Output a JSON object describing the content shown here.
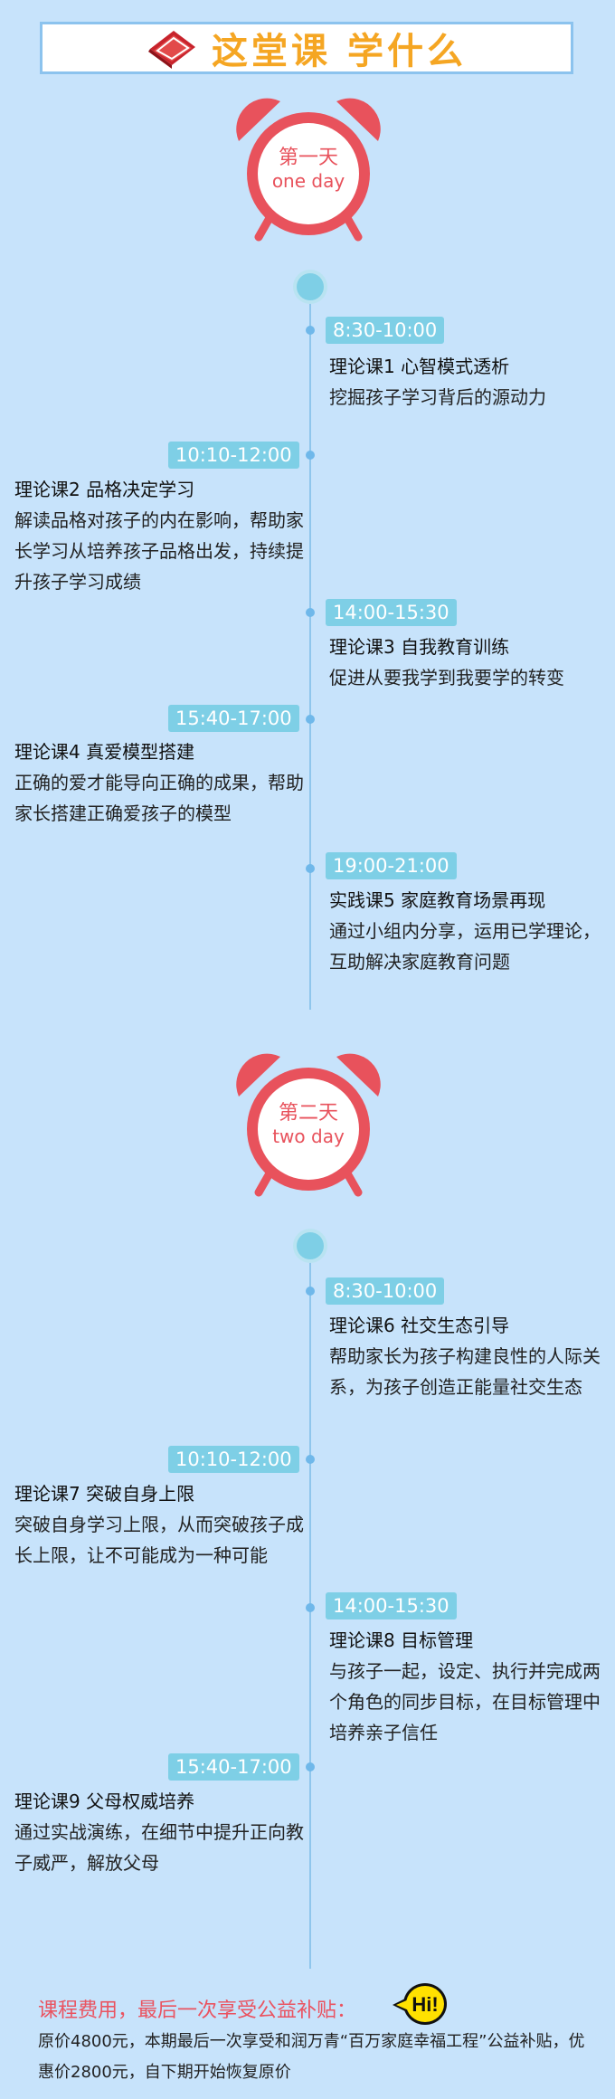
{
  "header": {
    "title": "这堂课 学什么"
  },
  "days": [
    {
      "cn": "第一天",
      "en": "one day",
      "items": [
        {
          "time": "8:30-10:00",
          "title": "理论课1 心智模式透析",
          "desc": "挖掘孩子学习背后的源动力"
        },
        {
          "time": "10:10-12:00",
          "title": "理论课2 品格决定学习",
          "desc": "解读品格对孩子的内在影响，帮助家长学习从培养孩子品格出发，持续提升孩子学习成绩"
        },
        {
          "time": "14:00-15:30",
          "title": "理论课3 自我教育训练",
          "desc": "促进从要我学到我要学的转变"
        },
        {
          "time": "15:40-17:00",
          "title": "理论课4 真爱模型搭建",
          "desc": "正确的爱才能导向正确的成果，帮助家长搭建正确爱孩子的模型"
        },
        {
          "time": "19:00-21:00",
          "title": "实践课5 家庭教育场景再现",
          "desc": "通过小组内分享，运用已学理论，互助解决家庭教育问题"
        }
      ]
    },
    {
      "cn": "第二天",
      "en": "two day",
      "items": [
        {
          "time": "8:30-10:00",
          "title": "理论课6 社交生态引导",
          "desc": "帮助家长为孩子构建良性的人际关系，为孩子创造正能量社交生态"
        },
        {
          "time": "10:10-12:00",
          "title": "理论课7 突破自身上限",
          "desc": "突破自身学习上限，从而突破孩子成长上限，让不可能成为一种可能"
        },
        {
          "time": "14:00-15:30",
          "title": "理论课8 目标管理",
          "desc": "与孩子一起，设定、执行并完成两个角色的同步目标，在目标管理中培养亲子信任"
        },
        {
          "time": "15:40-17:00",
          "title": "理论课9 父母权威培养",
          "desc": "通过实战演练，在细节中提升正向教子威严，解放父母"
        }
      ]
    }
  ],
  "footer": {
    "title": "课程费用，最后一次享受公益补贴：",
    "hi": "Hi!",
    "desc": "原价4800元，本期最后一次享受和润万青“百万家庭幸福工程”公益补贴，优惠价2800元，自下期开始恢复原价"
  },
  "colors": {
    "background": "#c7e3fb",
    "accent": "#e8525c",
    "badge": "#7ecfe6",
    "title": "#f5a623"
  }
}
